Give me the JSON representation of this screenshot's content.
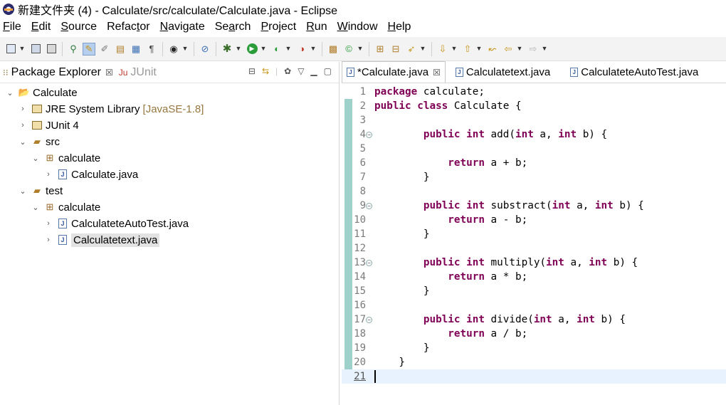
{
  "window": {
    "title": "新建文件夹 (4) - Calculate/src/calculate/Calculate.java - Eclipse"
  },
  "menubar": [
    {
      "mnemonic": "F",
      "rest": "ile"
    },
    {
      "mnemonic": "E",
      "rest": "dit"
    },
    {
      "mnemonic": "S",
      "rest": "ource"
    },
    {
      "pre": "Refac",
      "mnemonic": "t",
      "rest": "or"
    },
    {
      "mnemonic": "N",
      "rest": "avigate"
    },
    {
      "pre": "Se",
      "mnemonic": "a",
      "rest": "rch"
    },
    {
      "mnemonic": "P",
      "rest": "roject"
    },
    {
      "mnemonic": "R",
      "rest": "un"
    },
    {
      "mnemonic": "W",
      "rest": "indow"
    },
    {
      "mnemonic": "H",
      "rest": "elp"
    }
  ],
  "left_pane": {
    "tabs": [
      {
        "label": "Package Explorer",
        "close": "☒",
        "active": true
      },
      {
        "label": "JUnit",
        "active": false
      }
    ],
    "tree": [
      {
        "label": "Calculate",
        "twisty": "open",
        "icon": "project-icon",
        "depth": 0
      },
      {
        "label": "JRE System Library",
        "decoration": "[JavaSE-1.8]",
        "twisty": "closed",
        "icon": "library-icon",
        "depth": 1
      },
      {
        "label": "JUnit 4",
        "twisty": "closed",
        "icon": "library-icon",
        "depth": 1
      },
      {
        "label": "src",
        "twisty": "open",
        "icon": "source-folder-icon",
        "depth": 1
      },
      {
        "label": "calculate",
        "twisty": "open",
        "icon": "package-icon",
        "depth": 2
      },
      {
        "label": "Calculate.java",
        "twisty": "closed",
        "icon": "java-file-icon",
        "depth": 3
      },
      {
        "label": "test",
        "twisty": "open",
        "icon": "source-folder-icon",
        "depth": 1
      },
      {
        "label": "calculate",
        "twisty": "open",
        "icon": "package-icon",
        "depth": 2
      },
      {
        "label": "CalculateteAutoTest.java",
        "twisty": "closed",
        "icon": "java-file-icon",
        "depth": 3
      },
      {
        "label": "Calculatetext.java",
        "twisty": "closed",
        "icon": "java-file-icon",
        "depth": 3,
        "selected": true
      }
    ]
  },
  "editor": {
    "tabs": [
      {
        "label": "*Calculate.java",
        "close": "☒",
        "active": true
      },
      {
        "label": "Calculatetext.java",
        "active": false
      },
      {
        "label": "CalculateteAutoTest.java",
        "active": false
      }
    ],
    "current_line": 21,
    "lines": [
      {
        "n": "1",
        "code": "<span class='kw'>package</span> calculate;"
      },
      {
        "n": "2",
        "code": "<span class='kw'>public class</span> Calculate {"
      },
      {
        "n": "3",
        "code": ""
      },
      {
        "n": "4",
        "fold": true,
        "code": "        <span class='kw'>public int</span> add(<span class='kw'>int</span> a, <span class='kw'>int</span> b) {"
      },
      {
        "n": "5",
        "code": ""
      },
      {
        "n": "6",
        "code": "            <span class='kw'>return</span> a + b;"
      },
      {
        "n": "7",
        "code": "        }"
      },
      {
        "n": "8",
        "code": ""
      },
      {
        "n": "9",
        "fold": true,
        "code": "        <span class='kw'>public int</span> substract(<span class='kw'>int</span> a, <span class='kw'>int</span> b) {"
      },
      {
        "n": "10",
        "code": "            <span class='kw'>return</span> a - b;"
      },
      {
        "n": "11",
        "code": "        }"
      },
      {
        "n": "12",
        "code": ""
      },
      {
        "n": "13",
        "fold": true,
        "code": "        <span class='kw'>public int</span> multiply(<span class='kw'>int</span> a, <span class='kw'>int</span> b) {"
      },
      {
        "n": "14",
        "code": "            <span class='kw'>return</span> a * b;"
      },
      {
        "n": "15",
        "code": "        }"
      },
      {
        "n": "16",
        "code": ""
      },
      {
        "n": "17",
        "fold": true,
        "code": "        <span class='kw'>public int</span> divide(<span class='kw'>int</span> a, <span class='kw'>int</span> b) {"
      },
      {
        "n": "18",
        "code": "            <span class='kw'>return</span> a / b;"
      },
      {
        "n": "19",
        "code": "        }"
      },
      {
        "n": "20",
        "code": "    }"
      },
      {
        "n": "21",
        "code": ""
      }
    ]
  }
}
